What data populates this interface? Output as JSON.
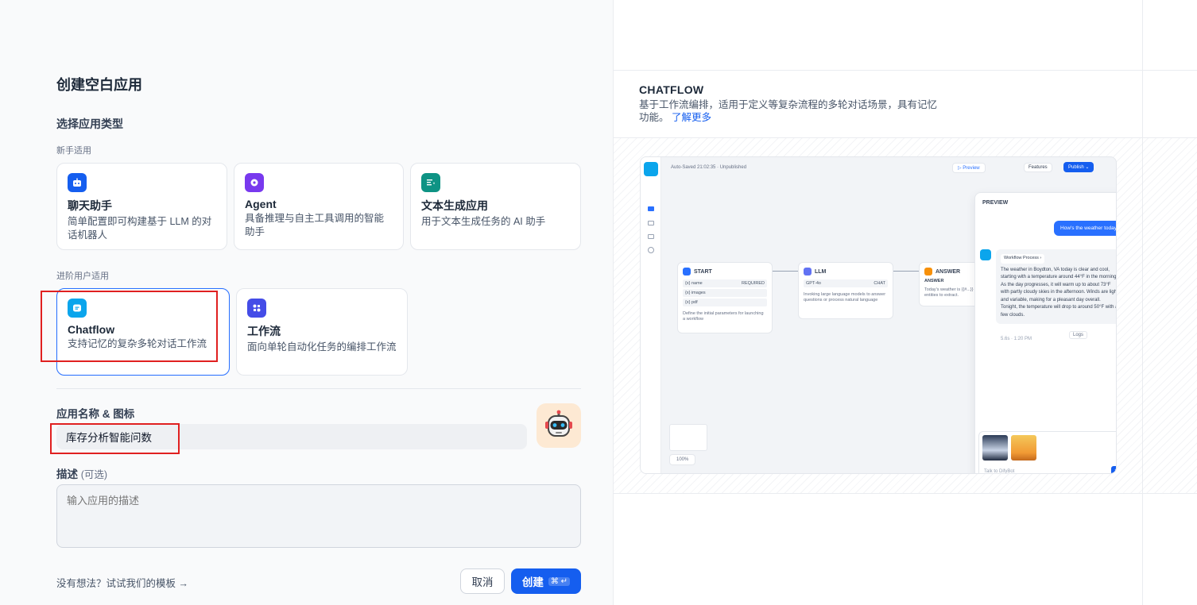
{
  "dialog": {
    "title": "创建空白应用",
    "choose_type_label": "选择应用类型",
    "beginner_label": "新手适用",
    "advanced_label": "进阶用户适用"
  },
  "app_types": {
    "beginner": [
      {
        "name": "聊天助手",
        "desc": "简单配置即可构建基于 LLM 的对话机器人",
        "icon": "chat-bot-icon",
        "color": "#155eef"
      },
      {
        "name": "Agent",
        "desc": "具备推理与自主工具调用的智能助手",
        "icon": "agent-brain-icon",
        "color": "#7839ee"
      },
      {
        "name": "文本生成应用",
        "desc": "用于文本生成任务的 AI 助手",
        "icon": "text-gen-icon",
        "color": "#0e9384"
      }
    ],
    "advanced": [
      {
        "name": "Chatflow",
        "desc": "支持记忆的复杂多轮对话工作流",
        "icon": "chatflow-icon",
        "color": "#0ba5ec",
        "selected": true
      },
      {
        "name": "工作流",
        "desc": "面向单轮自动化任务的编排工作流",
        "icon": "workflow-icon",
        "color": "#444ce7"
      }
    ]
  },
  "form": {
    "name_label": "应用名称 & 图标",
    "name_value": "库存分析智能问数",
    "desc_label": "描述",
    "desc_optional": "(可选)",
    "desc_placeholder": "输入应用的描述"
  },
  "footer": {
    "template_link": "没有想法？试试我们的模板 →",
    "cancel": "取消",
    "create": "创建",
    "create_shortcut": "⌘ ↵"
  },
  "preview_panel": {
    "title": "CHATFLOW",
    "desc": "基于工作流编排，适用于定义等复杂流程的多轮对话场景，具有记忆功能。",
    "learn_more": "了解更多"
  },
  "mock": {
    "autosave": "Auto-Saved 21:02:35 · Unpublished",
    "preview_btn": "▷ Preview",
    "features_btn": "Features",
    "publish_btn": "Publish ⌄",
    "start_title": "START",
    "start_rows": [
      "{x} name",
      "{x} images",
      "{x} pdf"
    ],
    "required_tag": "REQUIRED",
    "start_text": "Define the initial parameters for launching a workflow",
    "llm_title": "LLM",
    "llm_model": "GPT-4o",
    "llm_tag": "CHAT",
    "llm_text": "Invoking large language models to answer questions or process natural language",
    "answer_title": "ANSWER",
    "answer_label": "ANSWER",
    "answer_text": "Today's weather is {{#...}} entities to extract.",
    "zoom": "100%",
    "preview_title": "PREVIEW",
    "user_msg": "How's the weather today",
    "workflow_process": "Workflow Process  ›",
    "bot_msg": "The weather in Boydton, VA today is clear and cool, starting with a temperature around 44°F in the morning. As the day progresses, it will warm up to about 73°F with partly cloudy skies in the afternoon. Winds are light and variable, making for a pleasant day overall. Tonight, the temperature will drop to around 50°F with a few clouds.",
    "bot_time": "5.6s · 1:20 PM",
    "logs_btn": "Logs",
    "chat_placeholder": "Talk to DifyBot"
  }
}
